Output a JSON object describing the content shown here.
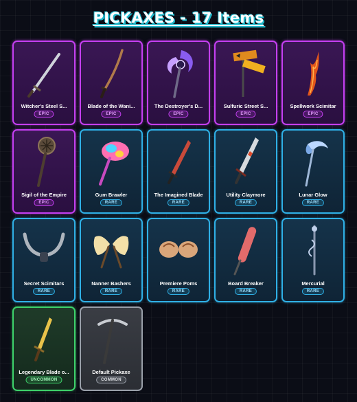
{
  "title": "PICKAXES - 17 Items",
  "items": [
    {
      "name": "Witcher's Steel S...",
      "rarity": "EPIC",
      "icon": "steel-sword-icon"
    },
    {
      "name": "Blade of the Wani...",
      "rarity": "EPIC",
      "icon": "katana-icon"
    },
    {
      "name": "The Destroyer's D...",
      "rarity": "EPIC",
      "icon": "crescent-axe-icon"
    },
    {
      "name": "Sulfuric Street S...",
      "rarity": "EPIC",
      "icon": "street-sign-icon"
    },
    {
      "name": "Spellwork Scimitar",
      "rarity": "EPIC",
      "icon": "flame-scimitar-icon"
    },
    {
      "name": "Sigil of the Empire",
      "rarity": "EPIC",
      "icon": "sigil-mace-icon"
    },
    {
      "name": "Gum Brawler",
      "rarity": "RARE",
      "icon": "gum-hammer-icon"
    },
    {
      "name": "The Imagined Blade",
      "rarity": "RARE",
      "icon": "red-blade-icon"
    },
    {
      "name": "Utility Claymore",
      "rarity": "RARE",
      "icon": "claymore-icon"
    },
    {
      "name": "Lunar Glow",
      "rarity": "RARE",
      "icon": "lunar-axe-icon"
    },
    {
      "name": "Secret Scimitars",
      "rarity": "RARE",
      "icon": "twin-scimitars-icon"
    },
    {
      "name": "Nanner Bashers",
      "rarity": "RARE",
      "icon": "banana-bashers-icon"
    },
    {
      "name": "Premiere Poms",
      "rarity": "RARE",
      "icon": "pom-poms-icon"
    },
    {
      "name": "Board Breaker",
      "rarity": "RARE",
      "icon": "skateboard-icon"
    },
    {
      "name": "Mercurial",
      "rarity": "RARE",
      "icon": "mercurial-staff-icon"
    },
    {
      "name": "Legendary Blade o...",
      "rarity": "UNCOMMON",
      "icon": "golden-sword-icon"
    },
    {
      "name": "Default Pickaxe",
      "rarity": "COMMON",
      "icon": "pickaxe-icon"
    }
  ],
  "colors": {
    "epic": "#c53ff2",
    "rare": "#2fb0e6",
    "uncommon": "#3ed36b",
    "common": "#9aa0aa",
    "title_shadow": "#1fb6c9"
  }
}
